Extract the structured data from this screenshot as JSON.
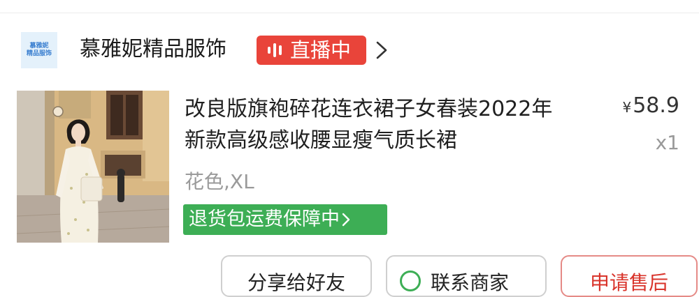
{
  "shop": {
    "logo_text_line1": "慕雅妮",
    "logo_text_line2": "精品服饰",
    "name": "慕雅妮精品服饰",
    "live_label": "直播中",
    "icons": {
      "live": "live-bars-icon",
      "chevron": "chevron-right-icon"
    },
    "colors": {
      "live_badge": "#e9443a"
    }
  },
  "product": {
    "title_line1": "改良版旗袍碎花连衣裙子女春装2022年",
    "title_line2": "新款高级感收腰显瘦气质长裙",
    "currency": "¥",
    "price": "58.9",
    "quantity": "x1",
    "spec": "花色,XL",
    "guarantee_label": "退货包运费保障中",
    "colors": {
      "guarantee": "#3dae55"
    }
  },
  "actions": {
    "share_label": "分享给好友",
    "contact_label": "联系商家",
    "aftersale_label": "申请售后",
    "colors": {
      "aftersale": "#d9342b"
    }
  }
}
